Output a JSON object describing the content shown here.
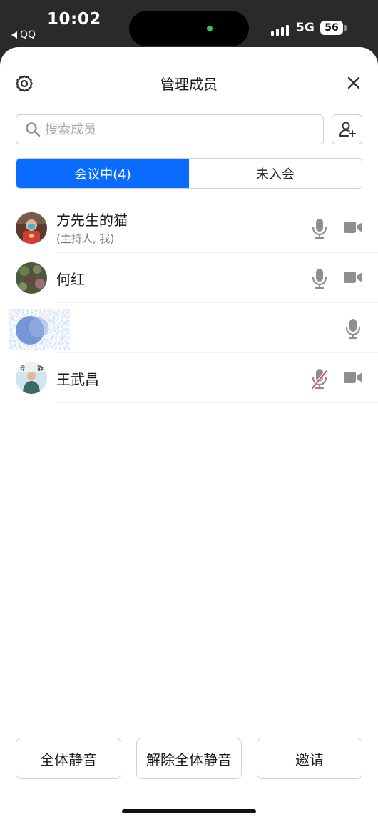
{
  "status_bar": {
    "time": "10:02",
    "back_app": "QQ",
    "network": "5G",
    "battery": "56"
  },
  "header": {
    "title": "管理成员",
    "settings_icon": "gear-icon",
    "close_icon": "close-icon"
  },
  "search": {
    "placeholder": "搜索成员",
    "value": ""
  },
  "tabs": [
    {
      "label": "会议中(4)",
      "active": true
    },
    {
      "label": "未入会",
      "active": false
    }
  ],
  "members": [
    {
      "name": "方先生的猫",
      "role": "(主持人, 我)",
      "mic": "on",
      "video": "off"
    },
    {
      "name": "何红",
      "role": "",
      "mic": "on",
      "video": "off"
    },
    {
      "name": "",
      "role": "",
      "mic": "on",
      "video": "none"
    },
    {
      "name": "王武昌",
      "role": "",
      "mic": "muted",
      "video": "off"
    }
  ],
  "actions": {
    "mute_all": "全体静音",
    "unmute_all": "解除全体静音",
    "invite": "邀请"
  },
  "colors": {
    "accent": "#0a6cff",
    "icon_gray": "#8e8e93",
    "mute_slash": "#e5484d"
  }
}
